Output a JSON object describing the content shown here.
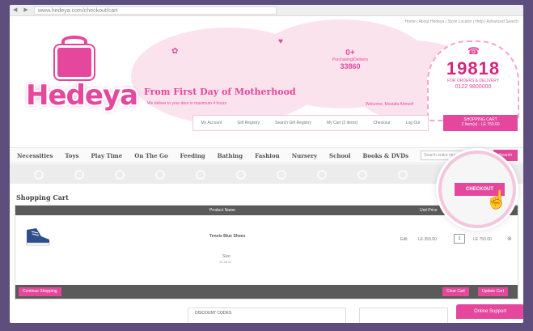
{
  "browser": {
    "nav": "◀ ▶ C",
    "url": "www.hedeya.com/checkout/cart"
  },
  "header": {
    "toplinks": "Home | About Hedeya | Store Locator | Help | Advanced Search",
    "logo_text": "Hedeya",
    "slogan": "From First Day of Motherhood",
    "subslogan": "We deliver to your door in maximum 4 hours",
    "welcome": "Welcome, Mostafa Ahmed!",
    "delivery": {
      "line1": "0+",
      "line2": "Purchasing/Delivery",
      "line3": "33860"
    },
    "hotline": {
      "icon": "phone-icon",
      "number": "19818",
      "sub": "FOR ORDERS & DELIVERY",
      "landline": "0122 9800000"
    },
    "cart_box": {
      "title": "SHOPPING CART",
      "summary": "2 Item(s) - LE 750.00"
    },
    "account_links": [
      "My Account",
      "Gift Registry",
      "Search Gift Registry",
      "My Cart (2 items)",
      "Checkout",
      "Log Out"
    ]
  },
  "menu": [
    "Necessities",
    "Toys",
    "Play Time",
    "On The Go",
    "Feeding",
    "Bathing",
    "Fashion",
    "Nursery",
    "School",
    "Books & DVDs"
  ],
  "search": {
    "placeholder": "Search entire store here...",
    "button": "Search"
  },
  "cart": {
    "title": "Shopping Cart",
    "columns": {
      "product": "Product Name",
      "price": "Unit Price"
    },
    "item": {
      "name": "Tennis Blue Shoes",
      "size_label": "Size",
      "size_value": "12-18 M",
      "edit": "Edit",
      "unit_price": "LE 350.00",
      "qty": "1",
      "subtotal": "LE 750.00"
    },
    "buttons": {
      "continue": "Continue Shopping",
      "clear": "Clear Cart",
      "update": "Update Cart"
    }
  },
  "bottom": {
    "discount": "DISCOUNT CODES"
  },
  "checkout_button": "CHECKOUT",
  "support": "Online Support",
  "colors": {
    "brand_pink": "#e4479c",
    "background": "#5d4e7e"
  }
}
